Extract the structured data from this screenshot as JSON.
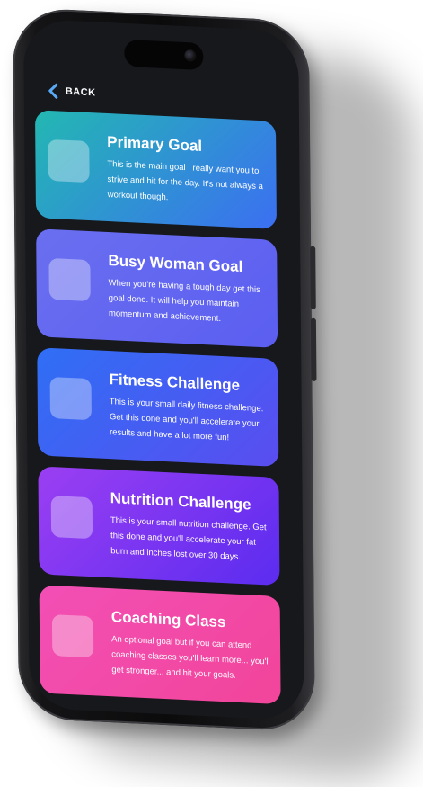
{
  "nav": {
    "back_label": "BACK"
  },
  "goals": [
    {
      "title": "Primary Goal",
      "description": "This is the main goal I really want you to strive and hit for the day. It's not always a workout though.",
      "gradient": [
        "#23b8b2",
        "#3b6ff2"
      ]
    },
    {
      "title": "Busy Woman Goal",
      "description": "When you're having a tough day get this goal done. It will help you maintain momentum and achievement.",
      "gradient": [
        "#6a6ff0",
        "#5b5ef0"
      ]
    },
    {
      "title": "Fitness Challenge",
      "description": "This is your small daily fitness challenge. Get this done and you'll accelerate your results and have a lot more fun!",
      "gradient": [
        "#2f6ff5",
        "#5a4df0"
      ]
    },
    {
      "title": "Nutrition Challenge",
      "description": "This is your small nutrition challenge. Get this done and you'll accelerate your fat burn and inches lost over 30 days.",
      "gradient": [
        "#9b3ff2",
        "#5b2cf0"
      ]
    },
    {
      "title": "Coaching Class",
      "description": "An optional goal but if you can attend coaching classes you'll learn more... you'll get stronger... and hit your goals.",
      "gradient": [
        "#f24fb5",
        "#f2459a"
      ]
    }
  ]
}
